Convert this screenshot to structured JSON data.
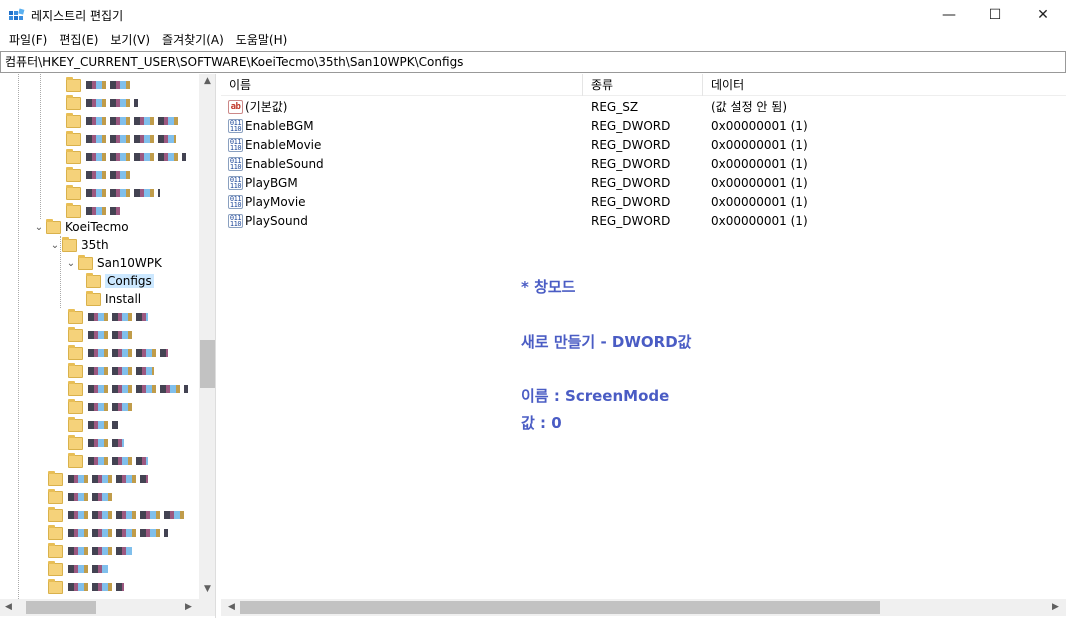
{
  "window": {
    "title": "레지스트리 편집기",
    "minimize_glyph": "—",
    "maximize_glyph": "☐",
    "close_glyph": "✕"
  },
  "menu": [
    "파일(F)",
    "편집(E)",
    "보기(V)",
    "즐겨찾기(A)",
    "도움말(H)"
  ],
  "address": "컴퓨터\\HKEY_CURRENT_USER\\SOFTWARE\\KoeiTecmo\\35th\\San10WPK\\Configs",
  "tree": {
    "items": [
      {
        "label": "KoeiTecmo"
      },
      {
        "label": "35th"
      },
      {
        "label": "San10WPK"
      },
      {
        "label": "Configs",
        "selected": true
      },
      {
        "label": "Install"
      }
    ]
  },
  "list": {
    "columns": [
      "이름",
      "종류",
      "데이터"
    ],
    "rows": [
      {
        "name": "(기본값)",
        "type": "REG_SZ",
        "data": "(값 설정 안 됨)",
        "icon": "string-value-icon"
      },
      {
        "name": "EnableBGM",
        "type": "REG_DWORD",
        "data": "0x00000001 (1)",
        "icon": "dword-value-icon"
      },
      {
        "name": "EnableMovie",
        "type": "REG_DWORD",
        "data": "0x00000001 (1)",
        "icon": "dword-value-icon"
      },
      {
        "name": "EnableSound",
        "type": "REG_DWORD",
        "data": "0x00000001 (1)",
        "icon": "dword-value-icon"
      },
      {
        "name": "PlayBGM",
        "type": "REG_DWORD",
        "data": "0x00000001 (1)",
        "icon": "dword-value-icon"
      },
      {
        "name": "PlayMovie",
        "type": "REG_DWORD",
        "data": "0x00000001 (1)",
        "icon": "dword-value-icon"
      },
      {
        "name": "PlaySound",
        "type": "REG_DWORD",
        "data": "0x00000001 (1)",
        "icon": "dword-value-icon"
      }
    ]
  },
  "notes": {
    "line1": "* 창모드",
    "line2": "새로 만들기 - DWORD값",
    "line3": "이름 : ScreenMode",
    "line4": "값 : 0"
  },
  "colors": {
    "note_text": "#4a5cc4",
    "selection": "#cce8ff"
  }
}
